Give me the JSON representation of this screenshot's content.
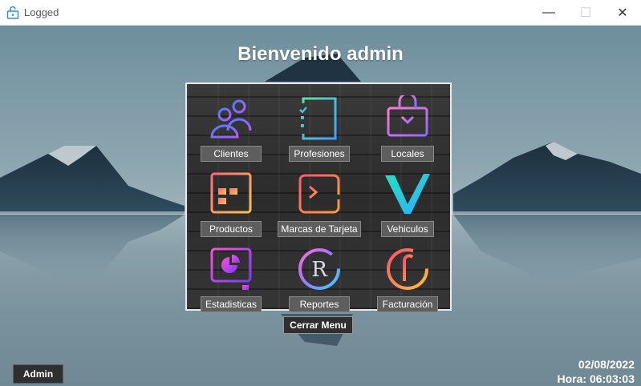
{
  "window": {
    "title": "Logged",
    "minimize_symbol": "—",
    "maximize_symbol": "☐",
    "close_symbol": "✕"
  },
  "welcome": "Bienvenido admin",
  "menu": {
    "items": [
      {
        "label": "Clientes",
        "icon": "users-icon"
      },
      {
        "label": "Profesiones",
        "icon": "checklist-icon"
      },
      {
        "label": "Locales",
        "icon": "store-download-icon"
      },
      {
        "label": "Productos",
        "icon": "product-window-icon"
      },
      {
        "label": "Marcas de Tarjeta",
        "icon": "terminal-icon"
      },
      {
        "label": "Vehiculos",
        "icon": "vehicle-v-icon"
      },
      {
        "label": "Estadisticas",
        "icon": "pie-chart-monitor-icon"
      },
      {
        "label": "Reportes",
        "icon": "r-logo-icon"
      },
      {
        "label": "Facturación",
        "icon": "invoice-f-icon"
      }
    ],
    "close_label": "Cerrar Menu"
  },
  "footer": {
    "user_label": "Admin",
    "date": "02/08/2022",
    "time": "Hora: 06:03:03"
  },
  "colors": {
    "panel_bg": "#2c2c2c",
    "button_bg": "#5e5e5e",
    "dark_button_bg": "#2f2f2f",
    "text_light": "#ffffff"
  }
}
